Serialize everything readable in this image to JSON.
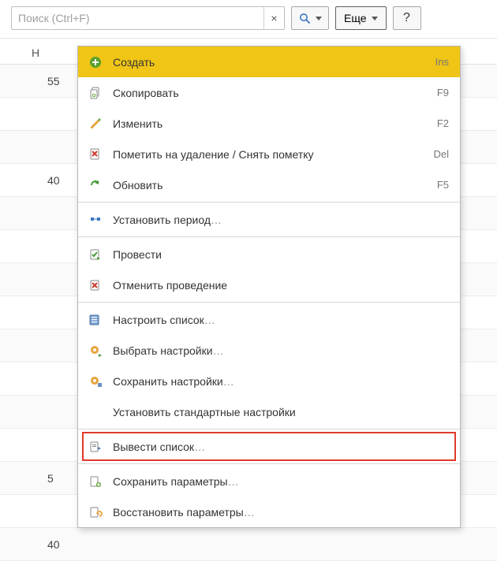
{
  "toolbar": {
    "search_placeholder": "Поиск (Ctrl+F)",
    "clear_label": "×",
    "more_label": "Еще",
    "help_label": "?"
  },
  "grid": {
    "header": "Н",
    "rows": [
      "55",
      "",
      "",
      "40",
      "",
      "",
      "",
      "",
      "",
      "",
      "",
      "",
      "5",
      "",
      "40"
    ]
  },
  "menu": {
    "items": [
      {
        "label": "Создать",
        "shortcut": "Ins",
        "icon": "plus-circle",
        "selected": true
      },
      {
        "label": "Скопировать",
        "shortcut": "F9",
        "icon": "copy-doc"
      },
      {
        "label": "Изменить",
        "shortcut": "F2",
        "icon": "pencil"
      },
      {
        "label": "Пометить на удаление / Снять пометку",
        "shortcut": "Del",
        "icon": "mark-delete"
      },
      {
        "label": "Обновить",
        "shortcut": "F5",
        "icon": "refresh"
      },
      {
        "sep": true
      },
      {
        "label": "Установить период",
        "ellipsis": true,
        "icon": "period"
      },
      {
        "sep": true
      },
      {
        "label": "Провести",
        "icon": "post"
      },
      {
        "label": "Отменить проведение",
        "icon": "unpost"
      },
      {
        "sep": true
      },
      {
        "label": "Настроить список",
        "ellipsis": true,
        "icon": "configure-list"
      },
      {
        "label": "Выбрать настройки",
        "ellipsis": true,
        "icon": "select-settings"
      },
      {
        "label": "Сохранить настройки",
        "ellipsis": true,
        "icon": "save-settings"
      },
      {
        "label": "Установить стандартные настройки",
        "icon": "blank"
      },
      {
        "sep": true
      },
      {
        "label": "Вывести список",
        "ellipsis": true,
        "icon": "output-list",
        "framed": true
      },
      {
        "sep": true
      },
      {
        "label": "Сохранить параметры",
        "ellipsis": true,
        "icon": "save-params"
      },
      {
        "label": "Восстановить параметры",
        "ellipsis": true,
        "icon": "restore-params"
      }
    ]
  }
}
